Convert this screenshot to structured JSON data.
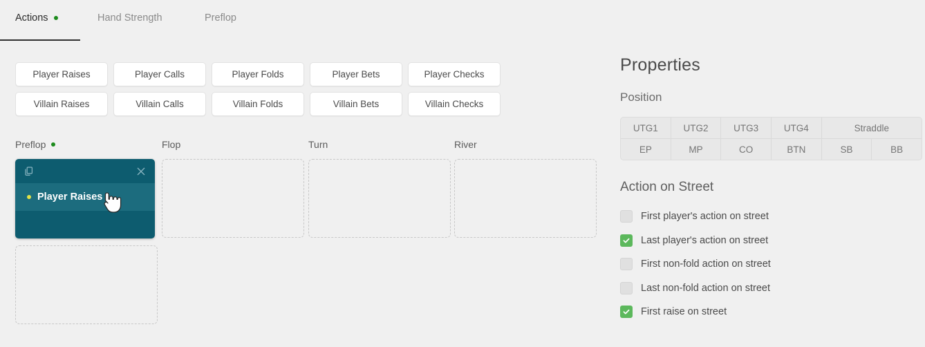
{
  "tabs": [
    {
      "label": "Actions",
      "active": true,
      "dot": true
    },
    {
      "label": "Hand Strength",
      "active": false,
      "dot": false
    },
    {
      "label": "Preflop",
      "active": false,
      "dot": false
    }
  ],
  "action_buttons": [
    "Player Raises",
    "Player Calls",
    "Player Folds",
    "Player Bets",
    "Player Checks",
    "Villain Raises",
    "Villain Calls",
    "Villain Folds",
    "Villain Bets",
    "Villain Checks"
  ],
  "streets": [
    {
      "label": "Preflop",
      "dot": true
    },
    {
      "label": "Flop",
      "dot": false
    },
    {
      "label": "Turn",
      "dot": false
    },
    {
      "label": "River",
      "dot": false
    }
  ],
  "card": {
    "copy_icon": "copy-icon",
    "close_icon": "close-icon",
    "action_label": "Player Raises",
    "bullet_color": "#e2e247",
    "header_color": "#0d5c6f",
    "band_color": "#1c6c7e"
  },
  "properties": {
    "title": "Properties",
    "position_label": "Position",
    "positions_row1": [
      {
        "label": "UTG1",
        "span": 1,
        "selected": false
      },
      {
        "label": "UTG2",
        "span": 1,
        "selected": false
      },
      {
        "label": "UTG3",
        "span": 1,
        "selected": false
      },
      {
        "label": "UTG4",
        "span": 1,
        "selected": false
      },
      {
        "label": "Straddle",
        "span": 2,
        "selected": false
      }
    ],
    "positions_row2": [
      {
        "label": "EP",
        "span": 1,
        "selected": false
      },
      {
        "label": "MP",
        "span": 1,
        "selected": false
      },
      {
        "label": "CO",
        "span": 1,
        "selected": false
      },
      {
        "label": "BTN",
        "span": 1,
        "selected": false
      },
      {
        "label": "SB",
        "span": 1,
        "selected": false
      },
      {
        "label": "BB",
        "span": 1,
        "selected": false
      }
    ],
    "action_on_street_label": "Action on Street",
    "checkboxes": [
      {
        "label": "First player's action on street",
        "checked": false
      },
      {
        "label": "Last player's action on street",
        "checked": true
      },
      {
        "label": "First non-fold action on street",
        "checked": false
      },
      {
        "label": "Last non-fold action on street",
        "checked": false
      },
      {
        "label": "First raise on street",
        "checked": true
      }
    ]
  },
  "colors": {
    "background": "#f0f0f0",
    "accent_green": "#1d8b1d",
    "checkbox_green": "#5cb85c",
    "card_teal": "#0d5c6f"
  }
}
